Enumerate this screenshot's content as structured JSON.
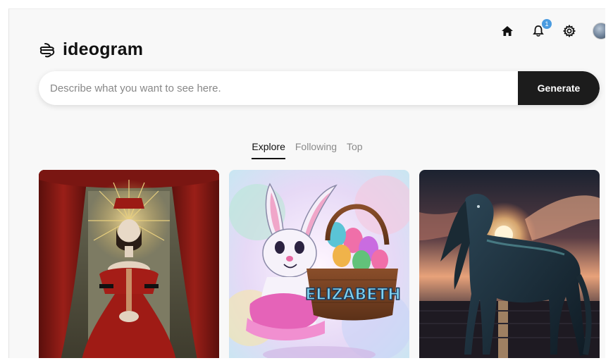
{
  "header": {
    "brand": "ideogram",
    "logo_icon": "ideogram-logo-icon",
    "icons": [
      "home-icon",
      "bell-icon",
      "gear-icon",
      "avatar"
    ],
    "notification_count": "1"
  },
  "search": {
    "placeholder": "Describe what you want to see here.",
    "value": "",
    "button_label": "Generate"
  },
  "tabs": [
    {
      "label": "Explore",
      "active": true
    },
    {
      "label": "Following",
      "active": false
    },
    {
      "label": "Top",
      "active": false
    }
  ],
  "gallery": [
    {
      "name": "woman-in-red-dress-image"
    },
    {
      "name": "easter-bunny-elizabeth-image",
      "text": "ELIZABETH"
    },
    {
      "name": "dark-horse-sunset-image"
    }
  ],
  "colors": {
    "accent": "#1c1c1c",
    "badge": "#4a9be0",
    "page_bg": "#f8f8f8"
  }
}
